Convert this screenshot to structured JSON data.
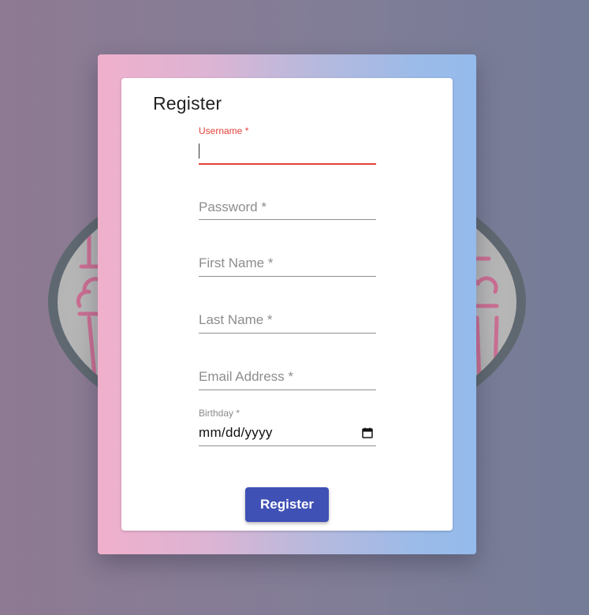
{
  "form": {
    "title": "Register",
    "fields": {
      "username": {
        "label": "Username *",
        "value": ""
      },
      "password": {
        "label": "Password *"
      },
      "first_name": {
        "label": "First Name *"
      },
      "last_name": {
        "label": "Last Name *"
      },
      "email": {
        "label": "Email Address *"
      },
      "birthday": {
        "label": "Birthday *",
        "value": "mm/dd/yyyy"
      }
    },
    "submit_label": "Register"
  },
  "icons": {
    "background": "popcorn-icon",
    "calendar": "calendar-icon"
  },
  "colors": {
    "accent_error": "#e24338",
    "primary_button": "#3f51b5",
    "text": "#222222",
    "muted": "#8d8d8d"
  }
}
